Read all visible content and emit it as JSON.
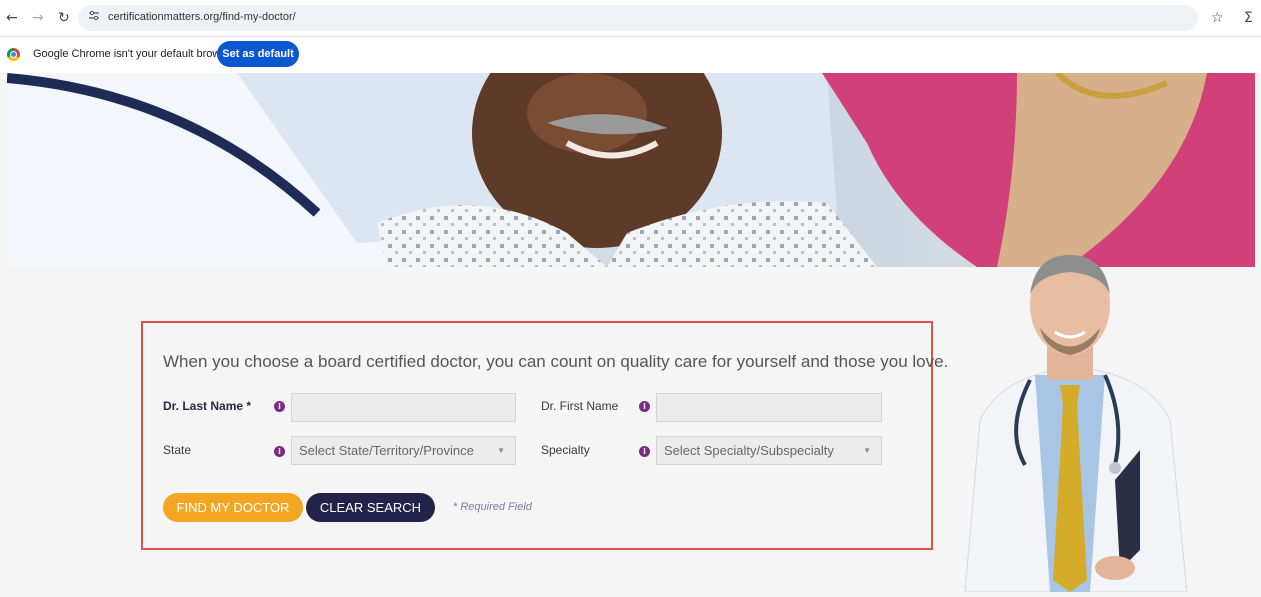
{
  "browser": {
    "url": "certificationmatters.org/find-my-doctor/",
    "icons": {
      "back": "back-arrow-icon",
      "forward": "forward-arrow-icon",
      "reload": "reload-icon",
      "site_info": "site-info-icon",
      "bookmark": "star-icon",
      "extension": "extensions-icon"
    },
    "infobar": {
      "message": "Google Chrome isn't your default browser",
      "button_label": "Set as default"
    }
  },
  "main": {
    "tagline": "When you choose a board certified doctor, you can count on quality care for yourself and those you love.",
    "form": {
      "last_name_label": "Dr. Last Name *",
      "first_name_label": "Dr. First Name",
      "state_label": "State",
      "state_placeholder": "Select State/Territory/Province",
      "specialty_label": "Specialty",
      "specialty_placeholder": "Select Specialty/Subspecialty",
      "find_button": "FIND MY DOCTOR",
      "clear_button": "CLEAR SEARCH",
      "required_note": "* Required Field"
    }
  },
  "colors": {
    "accent_orange": "#f4a623",
    "navy": "#23224a",
    "info_purple": "#7b2b83",
    "highlight_border": "#d9534f",
    "chrome_blue": "#0b57d0"
  }
}
